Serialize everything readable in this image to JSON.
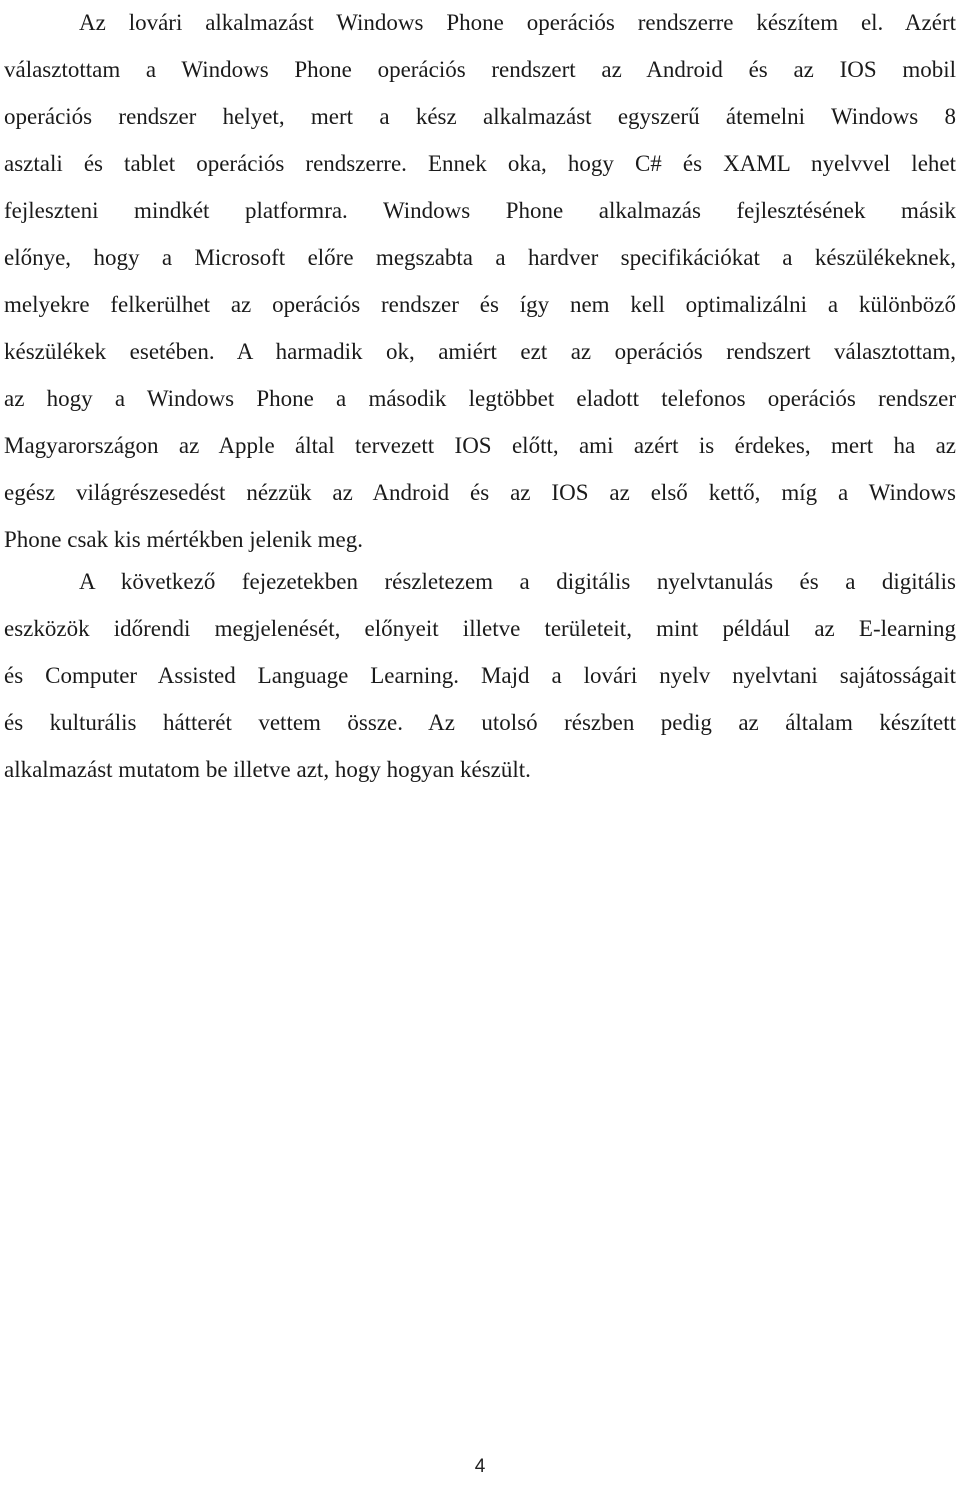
{
  "document": {
    "paragraphs": [
      {
        "lines": [
          "Az lovári alkalmazást Windows Phone operációs rendszerre készítem el. Azért",
          "választottam a Windows Phone operációs rendszert az Android és az IOS mobil",
          "operációs rendszer helyet, mert a kész alkalmazást egyszerű átemelni Windows 8",
          "asztali és tablet operációs rendszerre. Ennek oka, hogy C# és XAML nyelvvel lehet",
          "fejleszteni mindkét platformra.  Windows Phone alkalmazás fejlesztésének másik",
          "előnye, hogy a Microsoft előre megszabta a hardver specifikációkat a készülékeknek,",
          "melyekre felkerülhet az operációs rendszer és így nem kell optimalizálni a különböző",
          "készülékek esetében. A harmadik ok, amiért ezt az operációs rendszert választottam,",
          "az hogy a Windows Phone a második legtöbbet eladott telefonos operációs rendszer",
          "Magyarországon az Apple által tervezett IOS előtt, ami azért is érdekes, mert ha az",
          "egész világrészesedést nézzük az Android és az IOS az első kettő, míg a Windows",
          "Phone csak kis mértékben jelenik meg."
        ]
      },
      {
        "lines": [
          "A következő fejezetekben részletezem a digitális nyelvtanulás és a digitális",
          "eszközök időrendi megjelenését, előnyeit illetve területeit, mint például az E-learning",
          "és Computer Assisted Language Learning. Majd a lovári nyelv nyelvtani sajátosságait",
          "és kulturális hátterét vettem össze. Az utolsó részben pedig az általam készített",
          "alkalmazást mutatom be illetve azt, hogy hogyan készült."
        ]
      }
    ],
    "page_number": "4"
  }
}
